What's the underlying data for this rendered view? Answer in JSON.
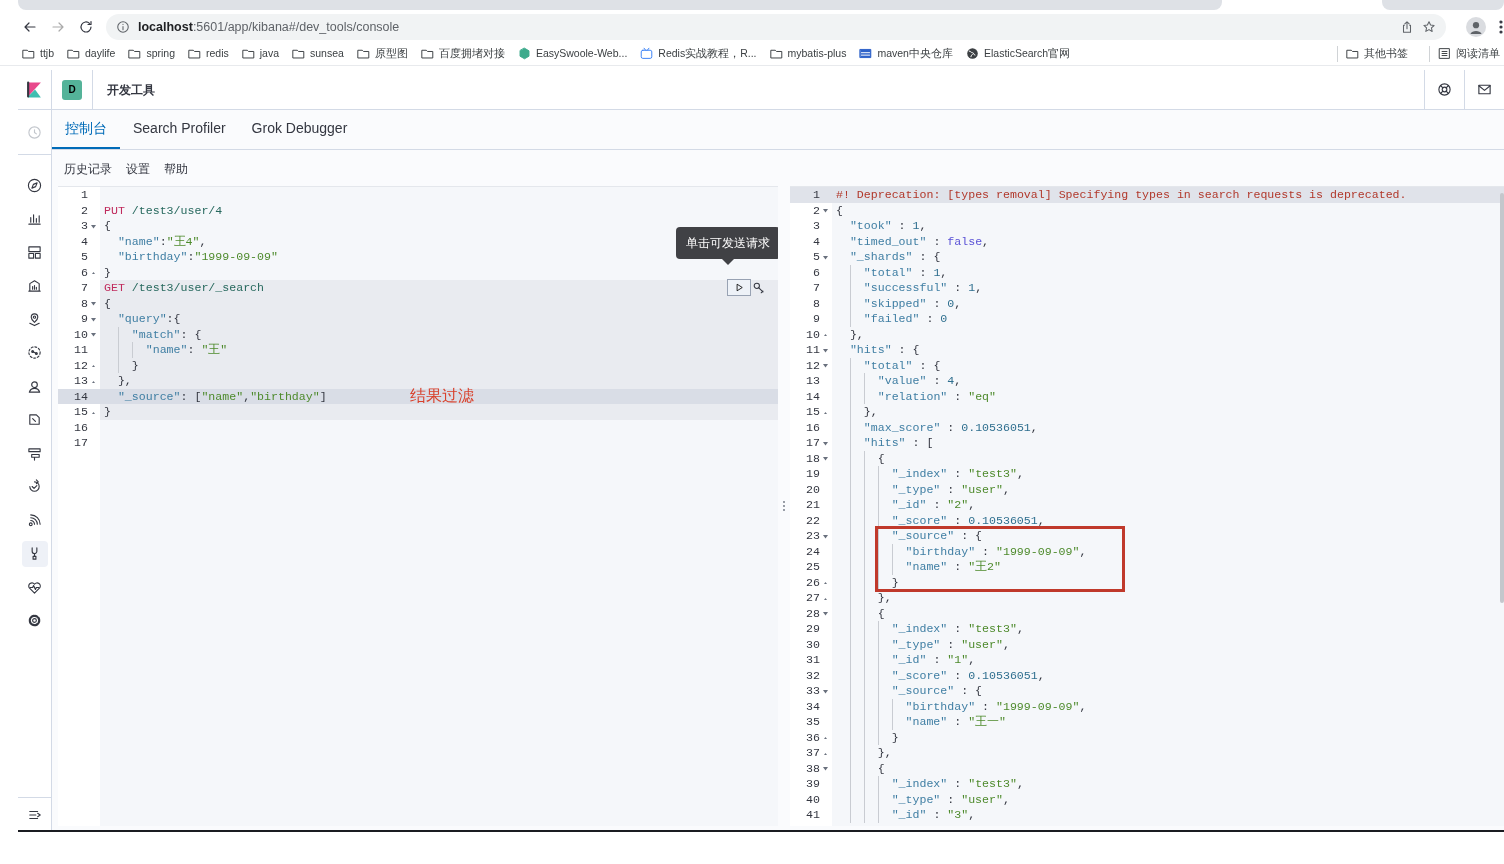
{
  "browser": {
    "address": "**localhost**:5601/app/kibana#/dev_tools/console",
    "bookmarks": [
      {
        "label": "ttjb",
        "kind": "folder"
      },
      {
        "label": "daylife",
        "kind": "folder"
      },
      {
        "label": "spring",
        "kind": "folder"
      },
      {
        "label": "redis",
        "kind": "folder"
      },
      {
        "label": "java",
        "kind": "folder"
      },
      {
        "label": "sunsea",
        "kind": "folder"
      },
      {
        "label": "原型图",
        "kind": "folder"
      },
      {
        "label": "百度拥堵对接",
        "kind": "folder"
      },
      {
        "label": "EasySwoole-Web...",
        "kind": "hexagon"
      },
      {
        "label": "Redis实战教程，R...",
        "kind": "tv"
      },
      {
        "label": "mybatis-plus",
        "kind": "folder"
      },
      {
        "label": "maven中央仓库",
        "kind": "badge"
      },
      {
        "label": "ElasticSearch官网",
        "kind": "globe"
      }
    ],
    "bookmarks_right": [
      {
        "label": "其他书签",
        "kind": "folder"
      },
      {
        "label": "阅读清单",
        "kind": "list"
      }
    ]
  },
  "app": {
    "space": "D",
    "title": "开发工具",
    "nav_items": [
      {
        "selected": false,
        "disabled": true
      },
      {
        "selected": false,
        "disabled": false
      },
      {
        "selected": false,
        "disabled": false
      },
      {
        "selected": false,
        "disabled": false
      },
      {
        "selected": false,
        "disabled": false
      },
      {
        "selected": false,
        "disabled": false
      },
      {
        "selected": false,
        "disabled": false
      },
      {
        "selected": false,
        "disabled": false
      },
      {
        "selected": false,
        "disabled": false
      },
      {
        "selected": false,
        "disabled": false
      },
      {
        "selected": false,
        "disabled": false
      },
      {
        "selected": false,
        "disabled": false
      },
      {
        "selected": true,
        "disabled": false
      },
      {
        "selected": false,
        "disabled": false
      },
      {
        "selected": false,
        "disabled": false
      }
    ],
    "tabs": [
      {
        "label": "控制台",
        "selected": true
      },
      {
        "label": "Search Profiler",
        "selected": false
      },
      {
        "label": "Grok Debugger",
        "selected": false
      }
    ],
    "menu": [
      "历史记录",
      "设置",
      "帮助"
    ],
    "request_tooltip": "单击可发送请求",
    "request": {
      "lines": [
        {
          "n": "1",
          "kind": "plain",
          "in_request": false,
          "cursor": false
        },
        {
          "n": "2",
          "kind": "plain",
          "in_request": false,
          "cursor": false,
          "tokens": [
            {
              "kind": "kw",
              "text": "PUT"
            },
            {
              "kind": "url",
              "text": " /test3/user/4"
            }
          ]
        },
        {
          "n": "3",
          "kind": "open",
          "in_request": false,
          "cursor": false,
          "tokens": [
            {
              "kind": "p",
              "text": "{"
            }
          ]
        },
        {
          "n": "4",
          "kind": "plain",
          "in_request": false,
          "cursor": false,
          "tokens": [
            {
              "kind": "key",
              "text": "  \"name\""
            },
            {
              "kind": "p",
              "text": ":"
            },
            {
              "kind": "str",
              "text": "\"王4\""
            },
            {
              "kind": "p",
              "text": ","
            }
          ]
        },
        {
          "n": "5",
          "kind": "plain",
          "in_request": false,
          "cursor": false,
          "tokens": [
            {
              "kind": "key",
              "text": "  \"birthday\""
            },
            {
              "kind": "p",
              "text": ":"
            },
            {
              "kind": "str",
              "text": "\"1999-09-09\""
            }
          ]
        },
        {
          "n": "6",
          "kind": "close",
          "in_request": false,
          "cursor": false,
          "tokens": [
            {
              "kind": "p",
              "text": "}"
            }
          ]
        },
        {
          "n": "7",
          "kind": "plain",
          "in_request": true,
          "cursor": false,
          "tokens": [
            {
              "kind": "kw",
              "text": "GET"
            },
            {
              "kind": "url",
              "text": " /test3/user/_search"
            }
          ]
        },
        {
          "n": "8",
          "kind": "open",
          "in_request": true,
          "cursor": false,
          "tokens": [
            {
              "kind": "p",
              "text": "{"
            }
          ]
        },
        {
          "n": "9",
          "kind": "open",
          "in_request": true,
          "cursor": false,
          "tokens": [
            {
              "kind": "key",
              "text": "  \"query\""
            },
            {
              "kind": "p",
              "text": ":{"
            }
          ]
        },
        {
          "n": "10",
          "kind": "open",
          "in_request": true,
          "cursor": false,
          "tokens": [
            {
              "kind": "key",
              "text": "    \"match\""
            },
            {
              "kind": "p",
              "text": ": {"
            }
          ]
        },
        {
          "n": "11",
          "kind": "plain",
          "in_request": true,
          "cursor": false,
          "tokens": [
            {
              "kind": "key",
              "text": "      \"name\""
            },
            {
              "kind": "p",
              "text": ": "
            },
            {
              "kind": "str",
              "text": "\"王\""
            }
          ]
        },
        {
          "n": "12",
          "kind": "close",
          "in_request": true,
          "cursor": false,
          "tokens": [
            {
              "kind": "p",
              "text": "    }"
            }
          ]
        },
        {
          "n": "13",
          "kind": "close",
          "in_request": true,
          "cursor": false,
          "tokens": [
            {
              "kind": "p",
              "text": "  },"
            }
          ]
        },
        {
          "n": "14",
          "kind": "plain",
          "in_request": true,
          "cursor": true,
          "note": "结果过滤",
          "tokens": [
            {
              "kind": "key",
              "text": "  \"_source\""
            },
            {
              "kind": "p",
              "text": ": ["
            },
            {
              "kind": "str",
              "text": "\"name\""
            },
            {
              "kind": "p",
              "text": ","
            },
            {
              "kind": "str",
              "text": "\"birthday\""
            },
            {
              "kind": "p",
              "text": "]"
            }
          ]
        },
        {
          "n": "15",
          "kind": "close",
          "in_request": true,
          "cursor": false,
          "tokens": [
            {
              "kind": "p",
              "text": "}"
            }
          ]
        },
        {
          "n": "16",
          "kind": "plain",
          "in_request": false,
          "cursor": false
        },
        {
          "n": "17",
          "kind": "plain",
          "in_request": false,
          "cursor": false
        }
      ]
    },
    "response": {
      "lines": [
        {
          "n": "1",
          "kind": "plain",
          "cursor": true,
          "boxed": false,
          "tokens": [
            {
              "kind": "comment",
              "text": "#! Deprecation: [types removal] Specifying types in search requests is deprecated."
            }
          ]
        },
        {
          "n": "2",
          "kind": "open",
          "cursor": false,
          "boxed": false,
          "tokens": [
            {
              "kind": "p",
              "text": "{"
            }
          ]
        },
        {
          "n": "3",
          "kind": "plain",
          "cursor": false,
          "boxed": false,
          "tokens": [
            {
              "kind": "key",
              "text": "  \"took\""
            },
            {
              "kind": "p",
              "text": " : "
            },
            {
              "kind": "num",
              "text": "1"
            },
            {
              "kind": "p",
              "text": ","
            }
          ]
        },
        {
          "n": "4",
          "kind": "plain",
          "cursor": false,
          "boxed": false,
          "tokens": [
            {
              "kind": "key",
              "text": "  \"timed_out\""
            },
            {
              "kind": "p",
              "text": " : "
            },
            {
              "kind": "bool",
              "text": "false"
            },
            {
              "kind": "p",
              "text": ","
            }
          ]
        },
        {
          "n": "5",
          "kind": "open",
          "cursor": false,
          "boxed": false,
          "tokens": [
            {
              "kind": "key",
              "text": "  \"_shards\""
            },
            {
              "kind": "p",
              "text": " : {"
            }
          ]
        },
        {
          "n": "6",
          "kind": "plain",
          "cursor": false,
          "boxed": false,
          "tokens": [
            {
              "kind": "key",
              "text": "    \"total\""
            },
            {
              "kind": "p",
              "text": " : "
            },
            {
              "kind": "num",
              "text": "1"
            },
            {
              "kind": "p",
              "text": ","
            }
          ]
        },
        {
          "n": "7",
          "kind": "plain",
          "cursor": false,
          "boxed": false,
          "tokens": [
            {
              "kind": "key",
              "text": "    \"successful\""
            },
            {
              "kind": "p",
              "text": " : "
            },
            {
              "kind": "num",
              "text": "1"
            },
            {
              "kind": "p",
              "text": ","
            }
          ]
        },
        {
          "n": "8",
          "kind": "plain",
          "cursor": false,
          "boxed": false,
          "tokens": [
            {
              "kind": "key",
              "text": "    \"skipped\""
            },
            {
              "kind": "p",
              "text": " : "
            },
            {
              "kind": "num",
              "text": "0"
            },
            {
              "kind": "p",
              "text": ","
            }
          ]
        },
        {
          "n": "9",
          "kind": "plain",
          "cursor": false,
          "boxed": false,
          "tokens": [
            {
              "kind": "key",
              "text": "    \"failed\""
            },
            {
              "kind": "p",
              "text": " : "
            },
            {
              "kind": "num",
              "text": "0"
            }
          ]
        },
        {
          "n": "10",
          "kind": "close",
          "cursor": false,
          "boxed": false,
          "tokens": [
            {
              "kind": "p",
              "text": "  },"
            }
          ]
        },
        {
          "n": "11",
          "kind": "open",
          "cursor": false,
          "boxed": false,
          "tokens": [
            {
              "kind": "key",
              "text": "  \"hits\""
            },
            {
              "kind": "p",
              "text": " : {"
            }
          ]
        },
        {
          "n": "12",
          "kind": "open",
          "cursor": false,
          "boxed": false,
          "tokens": [
            {
              "kind": "key",
              "text": "    \"total\""
            },
            {
              "kind": "p",
              "text": " : {"
            }
          ]
        },
        {
          "n": "13",
          "kind": "plain",
          "cursor": false,
          "boxed": false,
          "tokens": [
            {
              "kind": "key",
              "text": "      \"value\""
            },
            {
              "kind": "p",
              "text": " : "
            },
            {
              "kind": "num",
              "text": "4"
            },
            {
              "kind": "p",
              "text": ","
            }
          ]
        },
        {
          "n": "14",
          "kind": "plain",
          "cursor": false,
          "boxed": false,
          "tokens": [
            {
              "kind": "key",
              "text": "      \"relation\""
            },
            {
              "kind": "p",
              "text": " : "
            },
            {
              "kind": "str",
              "text": "\"eq\""
            }
          ]
        },
        {
          "n": "15",
          "kind": "close",
          "cursor": false,
          "boxed": false,
          "tokens": [
            {
              "kind": "p",
              "text": "    },"
            }
          ]
        },
        {
          "n": "16",
          "kind": "plain",
          "cursor": false,
          "boxed": false,
          "tokens": [
            {
              "kind": "key",
              "text": "    \"max_score\""
            },
            {
              "kind": "p",
              "text": " : "
            },
            {
              "kind": "num",
              "text": "0.10536051"
            },
            {
              "kind": "p",
              "text": ","
            }
          ]
        },
        {
          "n": "17",
          "kind": "open",
          "cursor": false,
          "boxed": false,
          "tokens": [
            {
              "kind": "key",
              "text": "    \"hits\""
            },
            {
              "kind": "p",
              "text": " : ["
            }
          ]
        },
        {
          "n": "18",
          "kind": "open",
          "cursor": false,
          "boxed": false,
          "tokens": [
            {
              "kind": "p",
              "text": "      {"
            }
          ]
        },
        {
          "n": "19",
          "kind": "plain",
          "cursor": false,
          "boxed": false,
          "tokens": [
            {
              "kind": "key",
              "text": "        \"_index\""
            },
            {
              "kind": "p",
              "text": " : "
            },
            {
              "kind": "str",
              "text": "\"test3\""
            },
            {
              "kind": "p",
              "text": ","
            }
          ]
        },
        {
          "n": "20",
          "kind": "plain",
          "cursor": false,
          "boxed": false,
          "tokens": [
            {
              "kind": "key",
              "text": "        \"_type\""
            },
            {
              "kind": "p",
              "text": " : "
            },
            {
              "kind": "str",
              "text": "\"user\""
            },
            {
              "kind": "p",
              "text": ","
            }
          ]
        },
        {
          "n": "21",
          "kind": "plain",
          "cursor": false,
          "boxed": false,
          "tokens": [
            {
              "kind": "key",
              "text": "        \"_id\""
            },
            {
              "kind": "p",
              "text": " : "
            },
            {
              "kind": "str",
              "text": "\"2\""
            },
            {
              "kind": "p",
              "text": ","
            }
          ]
        },
        {
          "n": "22",
          "kind": "plain",
          "cursor": false,
          "boxed": false,
          "tokens": [
            {
              "kind": "key",
              "text": "        \"_score\""
            },
            {
              "kind": "p",
              "text": " : "
            },
            {
              "kind": "num",
              "text": "0.10536051"
            },
            {
              "kind": "p",
              "text": ","
            }
          ]
        },
        {
          "n": "23",
          "kind": "open",
          "cursor": false,
          "boxed": true,
          "tokens": [
            {
              "kind": "key",
              "text": "        \"_source\""
            },
            {
              "kind": "p",
              "text": " : {"
            }
          ]
        },
        {
          "n": "24",
          "kind": "plain",
          "cursor": false,
          "boxed": true,
          "tokens": [
            {
              "kind": "key",
              "text": "          \"birthday\""
            },
            {
              "kind": "p",
              "text": " : "
            },
            {
              "kind": "str",
              "text": "\"1999-09-09\""
            },
            {
              "kind": "p",
              "text": ","
            }
          ]
        },
        {
          "n": "25",
          "kind": "plain",
          "cursor": false,
          "boxed": true,
          "tokens": [
            {
              "kind": "key",
              "text": "          \"name\""
            },
            {
              "kind": "p",
              "text": " : "
            },
            {
              "kind": "str",
              "text": "\"王2\""
            }
          ]
        },
        {
          "n": "26",
          "kind": "close",
          "cursor": false,
          "boxed": true,
          "tokens": [
            {
              "kind": "p",
              "text": "        }"
            }
          ]
        },
        {
          "n": "27",
          "kind": "close",
          "cursor": false,
          "boxed": false,
          "tokens": [
            {
              "kind": "p",
              "text": "      },"
            }
          ]
        },
        {
          "n": "28",
          "kind": "open",
          "cursor": false,
          "boxed": false,
          "tokens": [
            {
              "kind": "p",
              "text": "      {"
            }
          ]
        },
        {
          "n": "29",
          "kind": "plain",
          "cursor": false,
          "boxed": false,
          "tokens": [
            {
              "kind": "key",
              "text": "        \"_index\""
            },
            {
              "kind": "p",
              "text": " : "
            },
            {
              "kind": "str",
              "text": "\"test3\""
            },
            {
              "kind": "p",
              "text": ","
            }
          ]
        },
        {
          "n": "30",
          "kind": "plain",
          "cursor": false,
          "boxed": false,
          "tokens": [
            {
              "kind": "key",
              "text": "        \"_type\""
            },
            {
              "kind": "p",
              "text": " : "
            },
            {
              "kind": "str",
              "text": "\"user\""
            },
            {
              "kind": "p",
              "text": ","
            }
          ]
        },
        {
          "n": "31",
          "kind": "plain",
          "cursor": false,
          "boxed": false,
          "tokens": [
            {
              "kind": "key",
              "text": "        \"_id\""
            },
            {
              "kind": "p",
              "text": " : "
            },
            {
              "kind": "str",
              "text": "\"1\""
            },
            {
              "kind": "p",
              "text": ","
            }
          ]
        },
        {
          "n": "32",
          "kind": "plain",
          "cursor": false,
          "boxed": false,
          "tokens": [
            {
              "kind": "key",
              "text": "        \"_score\""
            },
            {
              "kind": "p",
              "text": " : "
            },
            {
              "kind": "num",
              "text": "0.10536051"
            },
            {
              "kind": "p",
              "text": ","
            }
          ]
        },
        {
          "n": "33",
          "kind": "open",
          "cursor": false,
          "boxed": false,
          "tokens": [
            {
              "kind": "key",
              "text": "        \"_source\""
            },
            {
              "kind": "p",
              "text": " : {"
            }
          ]
        },
        {
          "n": "34",
          "kind": "plain",
          "cursor": false,
          "boxed": false,
          "tokens": [
            {
              "kind": "key",
              "text": "          \"birthday\""
            },
            {
              "kind": "p",
              "text": " : "
            },
            {
              "kind": "str",
              "text": "\"1999-09-09\""
            },
            {
              "kind": "p",
              "text": ","
            }
          ]
        },
        {
          "n": "35",
          "kind": "plain",
          "cursor": false,
          "boxed": false,
          "tokens": [
            {
              "kind": "key",
              "text": "          \"name\""
            },
            {
              "kind": "p",
              "text": " : "
            },
            {
              "kind": "str",
              "text": "\"王一\""
            }
          ]
        },
        {
          "n": "36",
          "kind": "close",
          "cursor": false,
          "boxed": false,
          "tokens": [
            {
              "kind": "p",
              "text": "        }"
            }
          ]
        },
        {
          "n": "37",
          "kind": "close",
          "cursor": false,
          "boxed": false,
          "tokens": [
            {
              "kind": "p",
              "text": "      },"
            }
          ]
        },
        {
          "n": "38",
          "kind": "open",
          "cursor": false,
          "boxed": false,
          "tokens": [
            {
              "kind": "p",
              "text": "      {"
            }
          ]
        },
        {
          "n": "39",
          "kind": "plain",
          "cursor": false,
          "boxed": false,
          "tokens": [
            {
              "kind": "key",
              "text": "        \"_index\""
            },
            {
              "kind": "p",
              "text": " : "
            },
            {
              "kind": "str",
              "text": "\"test3\""
            },
            {
              "kind": "p",
              "text": ","
            }
          ]
        },
        {
          "n": "40",
          "kind": "plain",
          "cursor": false,
          "boxed": false,
          "tokens": [
            {
              "kind": "key",
              "text": "        \"_type\""
            },
            {
              "kind": "p",
              "text": " : "
            },
            {
              "kind": "str",
              "text": "\"user\""
            },
            {
              "kind": "p",
              "text": ","
            }
          ]
        },
        {
          "n": "41",
          "kind": "plain",
          "cursor": false,
          "boxed": false,
          "tokens": [
            {
              "kind": "key",
              "text": "        \"_id\""
            },
            {
              "kind": "p",
              "text": " : "
            },
            {
              "kind": "str",
              "text": "\"3\""
            },
            {
              "kind": "p",
              "text": ","
            }
          ]
        }
      ]
    }
  }
}
